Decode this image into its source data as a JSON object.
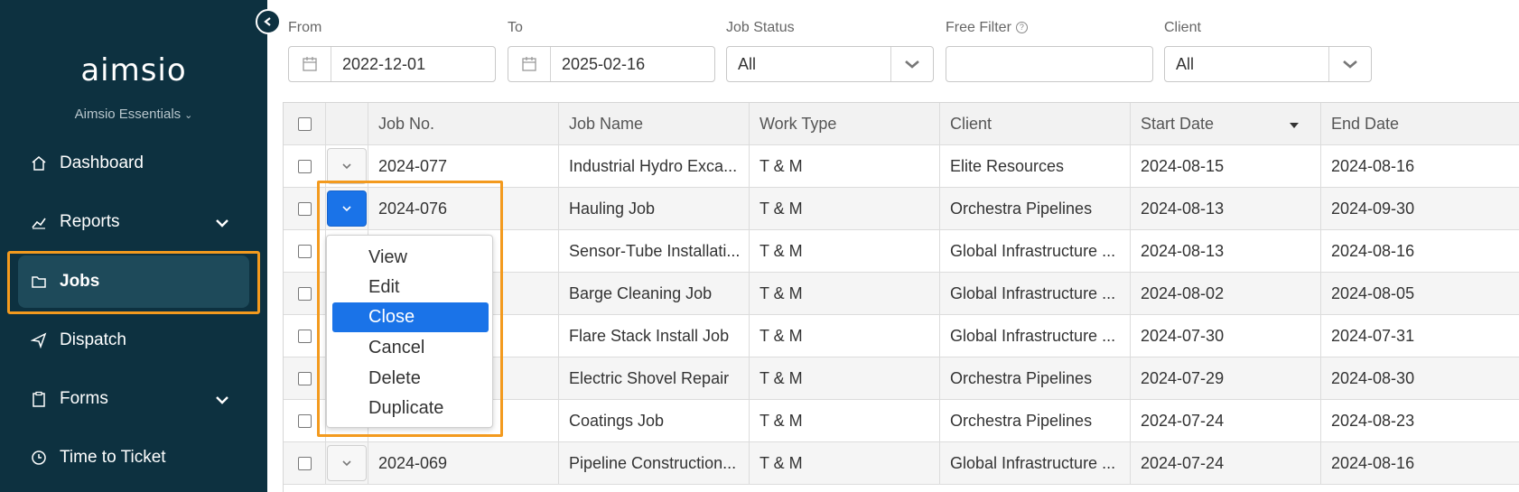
{
  "sidebar": {
    "logo": "aimsio",
    "org_name": "Aimsio Essentials",
    "items": [
      {
        "label": "Dashboard",
        "icon": "home-icon"
      },
      {
        "label": "Reports",
        "icon": "chart-icon",
        "expandable": true
      },
      {
        "label": "Jobs",
        "icon": "folder-icon",
        "active": true
      },
      {
        "label": "Dispatch",
        "icon": "send-icon"
      },
      {
        "label": "Forms",
        "icon": "clipboard-icon",
        "expandable": true
      },
      {
        "label": "Time to Ticket",
        "icon": "clock-icon"
      }
    ]
  },
  "filters": {
    "from_label": "From",
    "from_value": "2022-12-01",
    "to_label": "To",
    "to_value": "2025-02-16",
    "status_label": "Job Status",
    "status_value": "All",
    "free_label": "Free Filter",
    "free_value": "",
    "client_label": "Client",
    "client_value": "All"
  },
  "table": {
    "columns": [
      "Job No.",
      "Job Name",
      "Work Type",
      "Client",
      "Start Date",
      "End Date"
    ],
    "sorted_column": "Start Date",
    "rows": [
      {
        "no": "2024-077",
        "name": "Industrial Hydro Exca...",
        "work": "T & M",
        "client": "Elite Resources",
        "start": "2024-08-15",
        "end": "2024-08-16"
      },
      {
        "no": "2024-076",
        "name": "Hauling Job",
        "work": "T & M",
        "client": "Orchestra Pipelines",
        "start": "2024-08-13",
        "end": "2024-09-30"
      },
      {
        "no": "",
        "name": "Sensor-Tube Installati...",
        "work": "T & M",
        "client": "Global Infrastructure ...",
        "start": "2024-08-13",
        "end": "2024-08-16"
      },
      {
        "no": "",
        "name": "Barge Cleaning Job",
        "work": "T & M",
        "client": "Global Infrastructure ...",
        "start": "2024-08-02",
        "end": "2024-08-05"
      },
      {
        "no": "",
        "name": "Flare Stack Install Job",
        "work": "T & M",
        "client": "Global Infrastructure ...",
        "start": "2024-07-30",
        "end": "2024-07-31"
      },
      {
        "no": "",
        "name": "Electric Shovel Repair",
        "work": "T & M",
        "client": "Orchestra Pipelines",
        "start": "2024-07-29",
        "end": "2024-08-30"
      },
      {
        "no": "",
        "name": "Coatings Job",
        "work": "T & M",
        "client": "Orchestra Pipelines",
        "start": "2024-07-24",
        "end": "2024-08-23"
      },
      {
        "no": "2024-069",
        "name": "Pipeline Construction...",
        "work": "T & M",
        "client": "Global Infrastructure ...",
        "start": "2024-07-24",
        "end": "2024-08-16"
      }
    ]
  },
  "action_menu": {
    "items": [
      "View",
      "Edit",
      "Close",
      "Cancel",
      "Delete",
      "Duplicate"
    ],
    "selected": "Close"
  },
  "colors": {
    "sidebar_bg": "#0d3140",
    "accent_blue": "#1a73e8",
    "highlight_orange": "#f39a1e"
  }
}
